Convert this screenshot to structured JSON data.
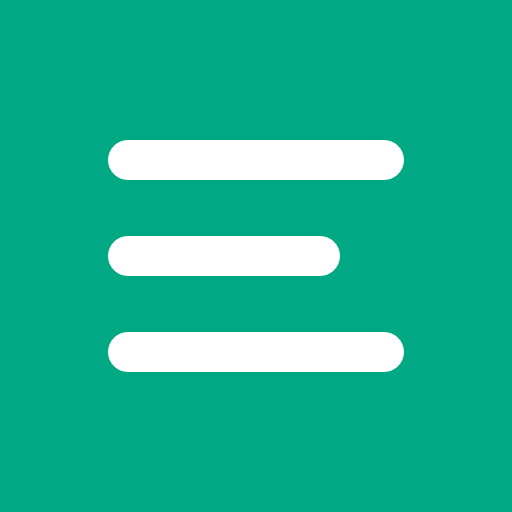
{
  "icon": {
    "name": "menu-lines-icon",
    "background_color": "#00A884",
    "line_color": "#FFFFFF",
    "line_count": 3
  }
}
